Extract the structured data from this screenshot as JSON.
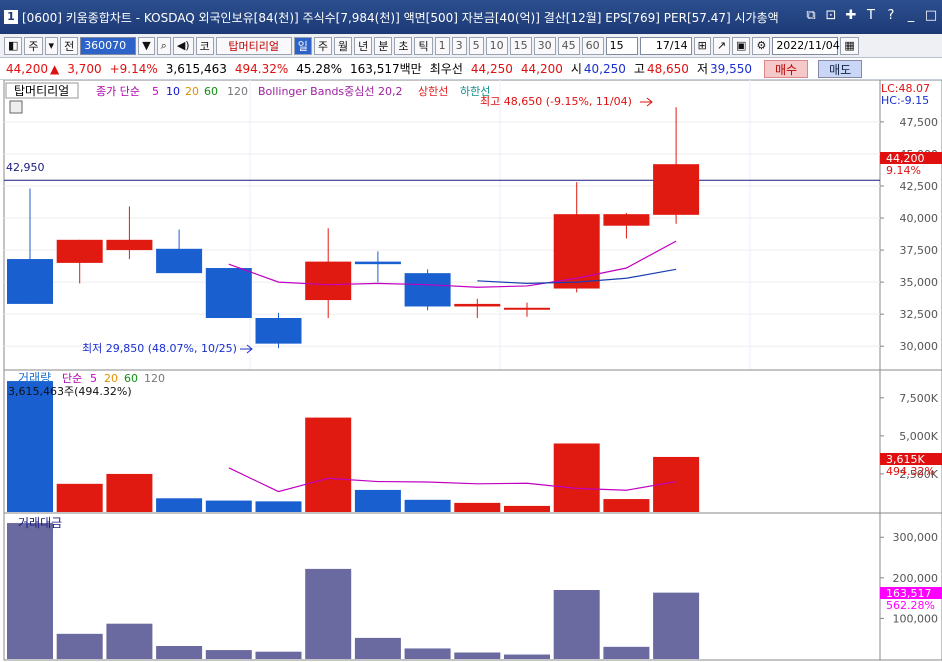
{
  "window": {
    "number": "1",
    "title": "[0600] 키움종합차트 - KOSDAQ 외국인보유[84(천)] 주식수[7,984(천)] 액면[500] 자본금[40(억)] 결산[12월] EPS[769] PER[57.47] 시가총액"
  },
  "toolbar": {
    "period": "주",
    "pre": "전",
    "code": "360070",
    "dropdown": "▼",
    "search": "Q",
    "sound": "🔈",
    "ko": "코",
    "name": "탑머티리얼",
    "tabs": [
      "일",
      "주",
      "월",
      "년",
      "분",
      "초",
      "틱"
    ],
    "active_tab": "일",
    "nums": [
      "1",
      "3",
      "5",
      "10",
      "15",
      "30",
      "45",
      "60"
    ],
    "count": "15",
    "page": "17/14",
    "date": "2022/11/04"
  },
  "status": {
    "price": "44,200",
    "up_mark": "▲",
    "change": "3,700",
    "pct": "+9.14%",
    "volume": "3,615,463",
    "vol_pct": "494.32%",
    "turnover": "45.28%",
    "amount": "163,517백만",
    "pri_label": "최우선",
    "pri_sell": "44,250",
    "pri_buy": "44,200",
    "open_label": "시",
    "open": "40,250",
    "high_label": "고",
    "high": "48,650",
    "low_label": "저",
    "low": "39,550",
    "buy_btn": "매수",
    "sell_btn": "매도"
  },
  "price_panel": {
    "name": "탑머티리얼",
    "ma_label": "종가 단순",
    "ma": [
      "5",
      "10",
      "20",
      "60",
      "120"
    ],
    "bb": "Bollinger Bands중심선 20,2",
    "upper": "상한선",
    "lower": "하한선",
    "hline": "42,950",
    "high_note": "최고 48,650 (-9.15%, 11/04)",
    "low_note": "최저 29,850 (48.07%, 10/25)",
    "lc": "LC:48.07",
    "hc": "HC:-9.15",
    "cur": "44,200",
    "cur_pct": "9.14%"
  },
  "volume_panel": {
    "label": "거래량",
    "ma_label": "단순",
    "ma": [
      "5",
      "20",
      "60",
      "120"
    ],
    "value": "3,615,463주(494.32%)",
    "cur": "3,615K",
    "cur_pct": "494.32%"
  },
  "amount_panel": {
    "label": "거래대금",
    "cur": "163,517",
    "cur_pct": "562.28%"
  },
  "chart_data": [
    {
      "type": "candlestick",
      "y_ticks": [
        "47,500",
        "45,000",
        "42,500",
        "40,000",
        "37,500",
        "35,000",
        "32,500",
        "30,000"
      ],
      "ylim": [
        28300,
        50300
      ],
      "candles": [
        {
          "o": 36800,
          "h": 42300,
          "l": 33300,
          "c": 33300
        },
        {
          "o": 36500,
          "h": 38300,
          "l": 34900,
          "c": 38300
        },
        {
          "o": 37500,
          "h": 40900,
          "l": 36800,
          "c": 38300
        },
        {
          "o": 37600,
          "h": 39100,
          "l": 35700,
          "c": 35700
        },
        {
          "o": 36100,
          "h": 36100,
          "l": 32200,
          "c": 32200
        },
        {
          "o": 32200,
          "h": 32600,
          "l": 29850,
          "c": 30200
        },
        {
          "o": 33600,
          "h": 39200,
          "l": 32200,
          "c": 36600
        },
        {
          "o": 36600,
          "h": 37400,
          "l": 35000,
          "c": 36400
        },
        {
          "o": 35700,
          "h": 36000,
          "l": 32800,
          "c": 33100
        },
        {
          "o": 33100,
          "h": 33700,
          "l": 32200,
          "c": 33300
        },
        {
          "o": 33000,
          "h": 33400,
          "l": 32300,
          "c": 33000
        },
        {
          "o": 34500,
          "h": 42800,
          "l": 34200,
          "c": 40300
        },
        {
          "o": 39400,
          "h": 40400,
          "l": 38400,
          "c": 40300
        },
        {
          "o": 40250,
          "h": 48650,
          "l": 39550,
          "c": 44200
        }
      ],
      "ma5": [
        null,
        null,
        null,
        null,
        36400,
        35000,
        34800,
        34900,
        34800,
        34600,
        34700,
        35300,
        36100,
        38200
      ],
      "bb_mid": [
        null,
        null,
        null,
        null,
        null,
        null,
        null,
        null,
        null,
        35100,
        34900,
        35000,
        35300,
        36000
      ]
    },
    {
      "type": "bar",
      "y_ticks": [
        "7,500K",
        "5,000K",
        "2,500K"
      ],
      "ylim": [
        0,
        8800000
      ],
      "values": [
        8600000,
        1850000,
        2500000,
        900000,
        750000,
        700000,
        6200000,
        1450000,
        800000,
        600000,
        400000,
        4500000,
        850000,
        3615463
      ],
      "ma5": [
        null,
        null,
        null,
        null,
        2900000,
        1340000,
        2210000,
        2000000,
        1970000,
        1850000,
        1890000,
        1550000,
        1430000,
        2000000
      ]
    },
    {
      "type": "bar",
      "y_ticks": [
        "300,000",
        "200,000",
        "100,000"
      ],
      "ylim": [
        0,
        340000
      ],
      "values": [
        335000,
        62000,
        87000,
        32000,
        22000,
        18000,
        222000,
        52000,
        26000,
        16000,
        11000,
        170000,
        30000,
        163517
      ]
    }
  ]
}
